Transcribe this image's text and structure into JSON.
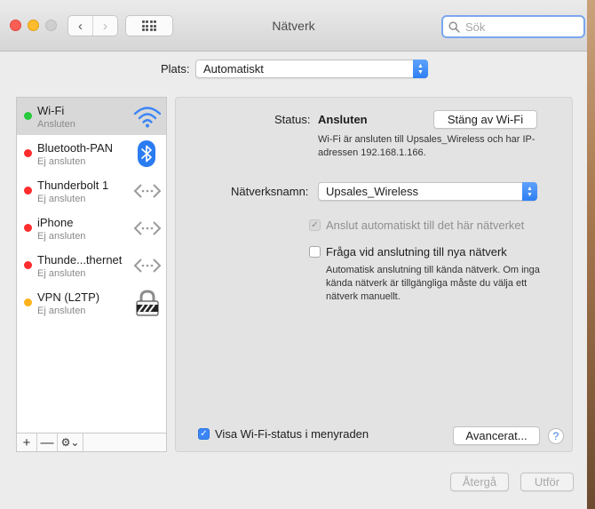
{
  "window": {
    "title": "Nätverk",
    "search_placeholder": "Sök"
  },
  "location": {
    "label": "Plats:",
    "value": "Automatiskt"
  },
  "services": [
    {
      "name": "Wi-Fi",
      "status": "Ansluten",
      "dot_color": "#27c93f",
      "icon": "wifi-icon",
      "selected": true
    },
    {
      "name": "Bluetooth-PAN",
      "status": "Ej ansluten",
      "dot_color": "#ff2d2d",
      "icon": "bluetooth-icon"
    },
    {
      "name": "Thunderbolt 1",
      "status": "Ej ansluten",
      "dot_color": "#ff2d2d",
      "icon": "ethernet-arrows-icon"
    },
    {
      "name": "iPhone",
      "status": "Ej ansluten",
      "dot_color": "#ff2d2d",
      "icon": "ethernet-arrows-icon"
    },
    {
      "name": "Thunde...thernet",
      "status": "Ej ansluten",
      "dot_color": "#ff2d2d",
      "icon": "ethernet-arrows-icon"
    },
    {
      "name": "VPN (L2TP)",
      "status": "Ej ansluten",
      "dot_color": "#ffb31a",
      "icon": "vpn-lock-icon"
    }
  ],
  "sidebar_footer": {
    "add": "+",
    "remove": "—",
    "gear": "⚙︎⌄"
  },
  "detail": {
    "status_label": "Status:",
    "status_value": "Ansluten",
    "turn_off_button": "Stäng av Wi-Fi",
    "status_description": "Wi-Fi är ansluten till Upsales_Wireless och har IP-adressen 192.168.1.166.",
    "network_name_label": "Nätverksnamn:",
    "network_name_value": "Upsales_Wireless",
    "auto_join_label": "Anslut automatiskt till det här nätverket",
    "ask_join_label": "Fråga vid anslutning till nya nätverk",
    "ask_join_description": "Automatisk anslutning till kända nätverk. Om inga kända nätverk är tillgängliga måste du välja ett nätverk manuellt.",
    "show_status_label": "Visa Wi-Fi-status i menyraden",
    "advanced_button": "Avancerat...",
    "help": "?"
  },
  "footer": {
    "revert_button": "Återgå",
    "apply_button": "Utför"
  },
  "colors": {
    "accent": "#3b86f7",
    "connected": "#27c93f",
    "disconnected": "#ff2d2d",
    "inactive": "#ffb31a"
  }
}
